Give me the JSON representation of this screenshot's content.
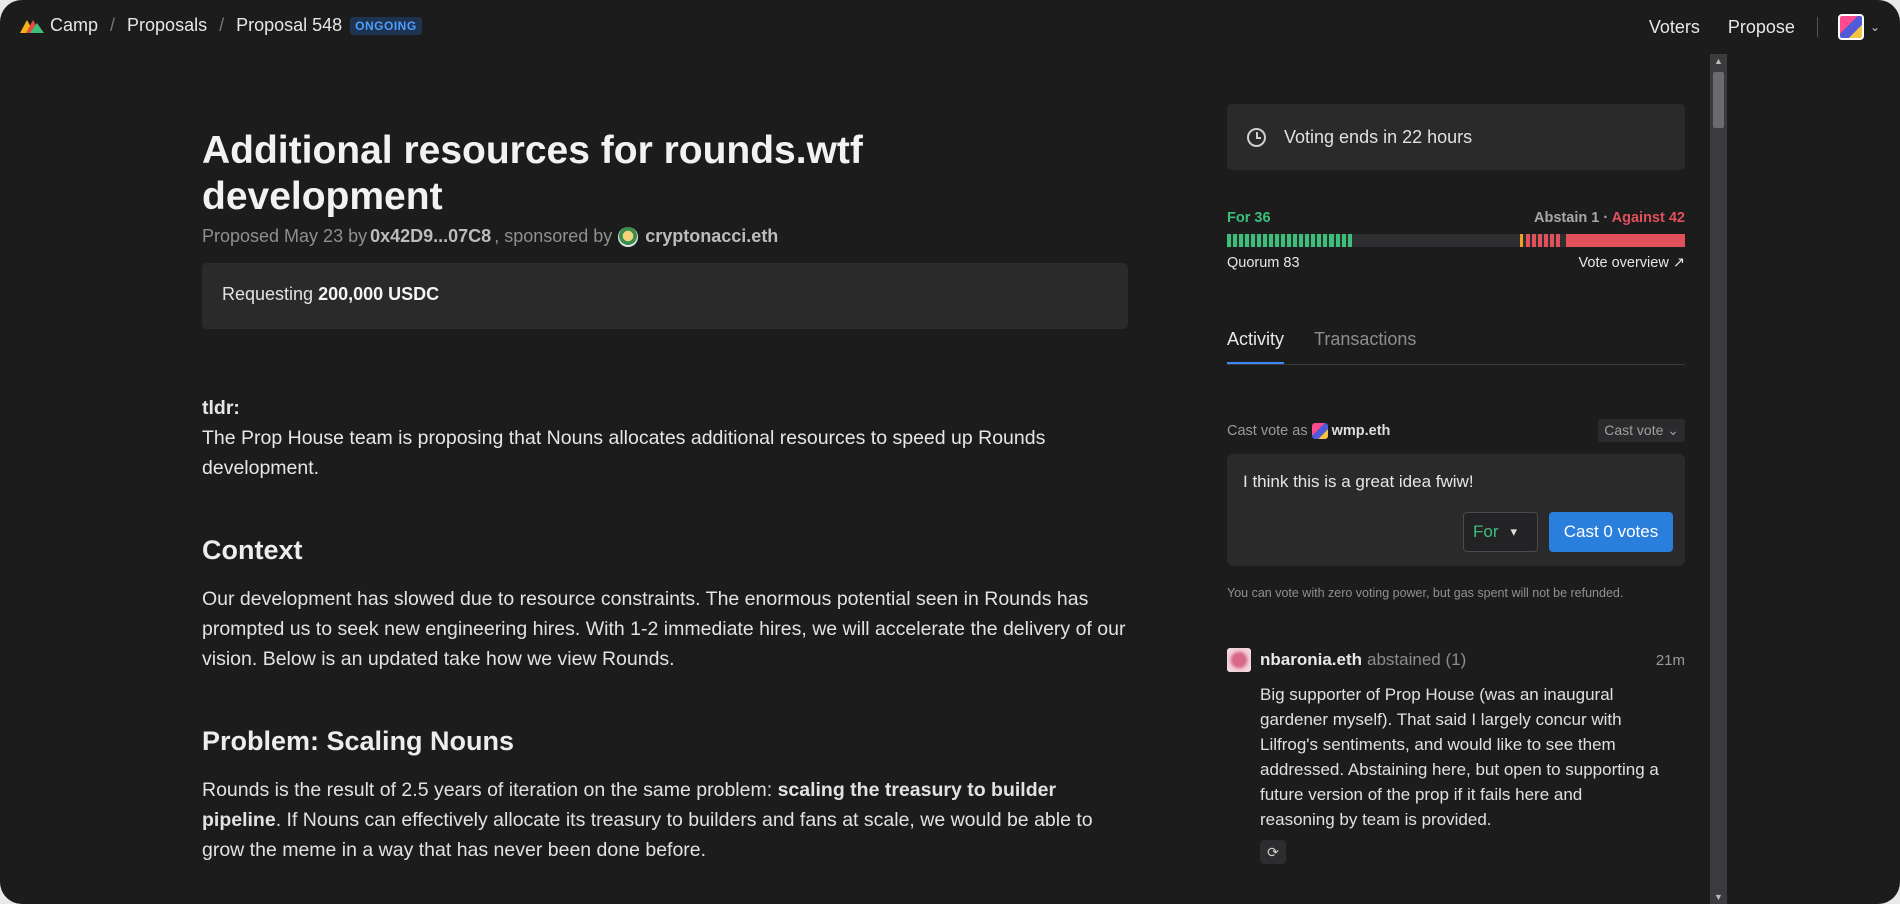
{
  "header": {
    "breadcrumbs": [
      "Camp",
      "Proposals",
      "Proposal 548"
    ],
    "status_badge": "ONGOING",
    "nav": [
      "Voters",
      "Propose"
    ]
  },
  "proposal": {
    "title": "Additional resources for rounds.wtf development",
    "byline_prefix": "Proposed May 23 by",
    "proposer": "0x42D9...07C8",
    "byline_mid": ", sponsored by",
    "sponsor": "cryptonacci.eth",
    "request_prefix": "Requesting",
    "request_amount": "200,000 USDC",
    "tldr_label": "tldr:",
    "tldr_text": "The Prop House team is proposing that Nouns allocates additional resources to speed up Rounds development.",
    "sections": [
      {
        "heading": "Context",
        "text": "Our development has slowed due to resource constraints. The enormous potential seen in Rounds has prompted us to seek new engineering hires. With 1-2 immediate hires, we will accelerate the delivery of our vision. Below is an updated take how we view Rounds."
      },
      {
        "heading": "Problem: Scaling Nouns",
        "text_before_bold": "Rounds is the result of 2.5 years of iteration on the same problem: ",
        "text_bold": "scaling the treasury to builder pipeline",
        "text_after_bold": ". If Nouns can effectively allocate its treasury to builders and fans at scale, we would be able to grow the meme in a way that has never been done before."
      }
    ]
  },
  "sidebar": {
    "voting_ends": "Voting ends in 22 hours",
    "for_label": "For 36",
    "abstain_label": "Abstain 1",
    "against_label": "Against 42",
    "tally_sep": " · ",
    "quorum_label": "Quorum 83",
    "vote_overview": "Vote overview ↗",
    "votes": {
      "for": 36,
      "abstain": 1,
      "against": 42,
      "quorum": 83
    },
    "tabs": [
      "Activity",
      "Transactions"
    ],
    "cast_as_prefix": "Cast vote as",
    "cast_as_user": "wmp.eth",
    "cast_vote_select": "Cast vote",
    "vote_reason": "I think this is a great idea fwiw!",
    "support_option": "For",
    "cast_button": "Cast 0 votes",
    "note": "You can vote with zero voting power, but gas spent will not be refunded.",
    "feed": [
      {
        "user": "nbaronia.eth",
        "action": "abstained (1)",
        "time": "21m",
        "body": "Big supporter of Prop House (was an inaugural gardener myself). That said I largely concur with Lilfrog's sentiments, and would like to see them addressed. Abstaining here, but open to supporting a future version of the prop if it fails here and reasoning by team is provided."
      }
    ]
  },
  "colors": {
    "background": "#1c1c1d",
    "card": "#2a2a2b",
    "for": "#3bbf79",
    "against": "#e2505c",
    "abstain": "#f0a020",
    "accent": "#2b7fdc",
    "badge": "#4d9fff"
  }
}
